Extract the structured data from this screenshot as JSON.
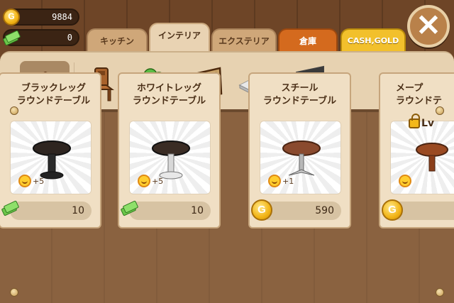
{
  "hud": {
    "gold": "9884",
    "cash": "0"
  },
  "tabs": [
    {
      "label": "キッチン",
      "state": "normal"
    },
    {
      "label": "インテリア",
      "state": "active"
    },
    {
      "label": "エクステリア",
      "state": "normal"
    },
    {
      "label": "倉庫",
      "state": "highlight"
    },
    {
      "label": "CASH,GOLD",
      "state": "shop"
    }
  ],
  "close_label": "✕",
  "categories": [
    {
      "icon": "table-icon",
      "active": true
    },
    {
      "icon": "chair-icon",
      "active": false
    },
    {
      "icon": "plant-box-icon",
      "active": false
    },
    {
      "icon": "picture-frame-icon",
      "active": false
    },
    {
      "icon": "floor-tile-icon",
      "active": false
    },
    {
      "icon": "wall-panel-icon",
      "active": false
    }
  ],
  "items": [
    {
      "name_line1": "ブラックレッグ",
      "name_line2": "ラウンドテーブル",
      "points": "+5",
      "price": "10",
      "currency": "cash",
      "locked": false
    },
    {
      "name_line1": "ホワイトレッグ",
      "name_line2": "ラウンドテーブル",
      "points": "+5",
      "price": "10",
      "currency": "cash",
      "locked": false
    },
    {
      "name_line1": "スチール",
      "name_line2": "ラウンドテーブル",
      "points": "+1",
      "price": "590",
      "currency": "gold",
      "locked": false
    },
    {
      "name_line1": "メープ",
      "name_line2": "ラウンドテ",
      "points": "",
      "price": "",
      "currency": "gold",
      "locked": true,
      "lock_label": "Lv"
    }
  ],
  "colors": {
    "panel": "#e7d2b1",
    "storage_tab": "#d46a1e",
    "cash_tab": "#f2c02c",
    "coin": "#f2b416",
    "cash_bill": "#6cc64a"
  }
}
